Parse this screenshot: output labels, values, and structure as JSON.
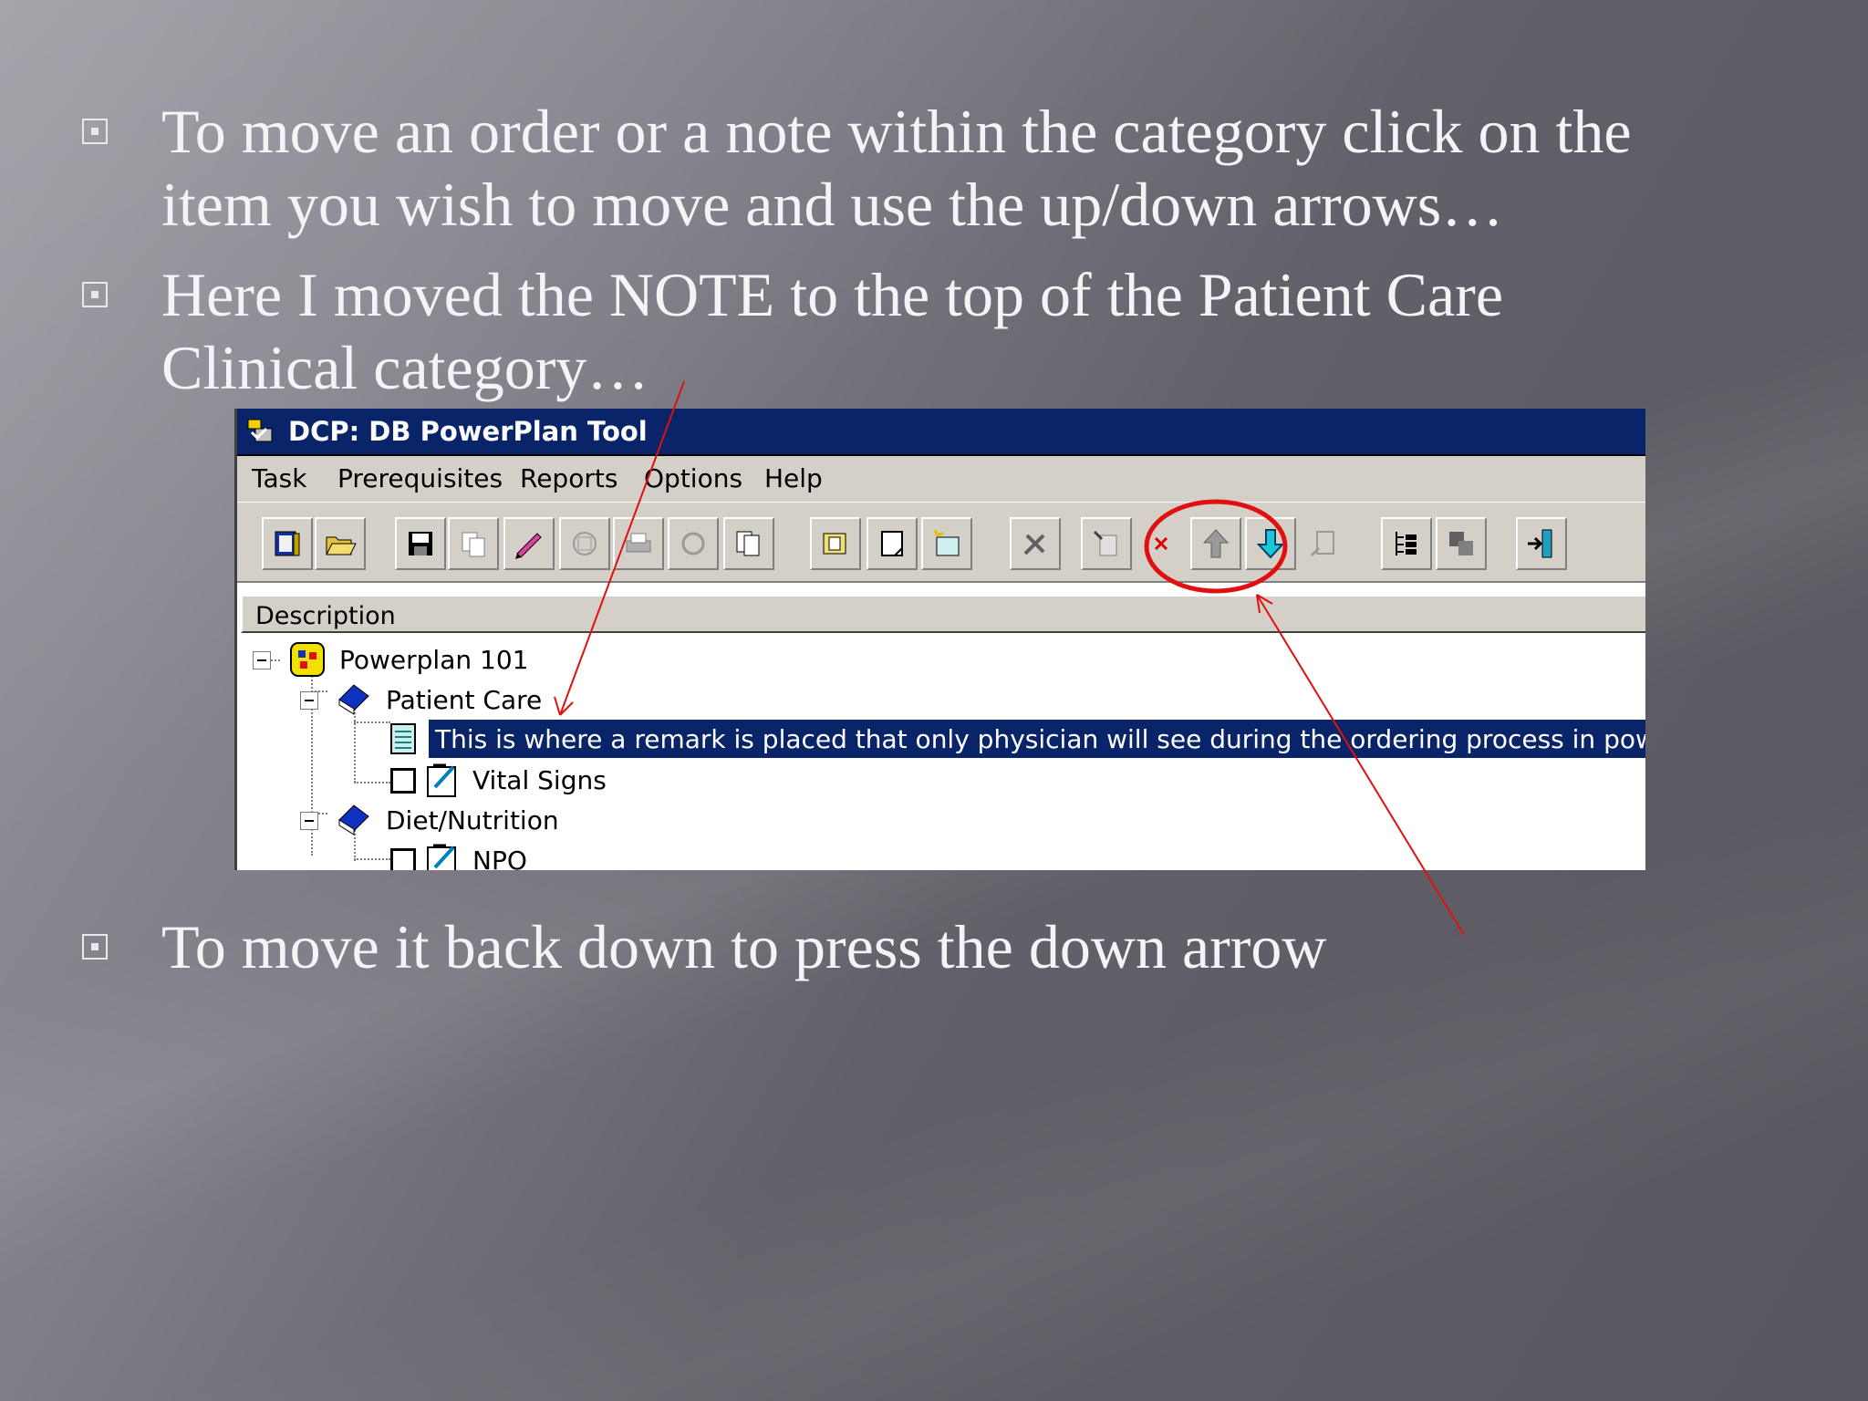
{
  "bullets": [
    {
      "line1": "To move an order or a note within the category click on the",
      "line2": "item you wish to move and use the up/down arrows…"
    },
    {
      "line1": "Here I moved the NOTE to the top of the Patient Care",
      "line2": "Clinical category…"
    },
    {
      "line1": "To move it back down to press the down arrow"
    }
  ],
  "window": {
    "title": "DCP: DB PowerPlan Tool",
    "menu": [
      "Task",
      "Prerequisites",
      "Reports",
      "Options",
      "Help"
    ],
    "column_header": "Description",
    "tree": {
      "root": "Powerplan 101",
      "cat1": "Patient Care",
      "note": "This is where a remark is placed that only physician will see during the ordering process in powerchart",
      "item1": "Vital Signs",
      "cat2": "Diet/Nutrition",
      "item2": "NPO"
    }
  },
  "colors": {
    "titlebar": "#0a246a",
    "highlight_circle": "#e01010",
    "arrow": "#e01010"
  }
}
